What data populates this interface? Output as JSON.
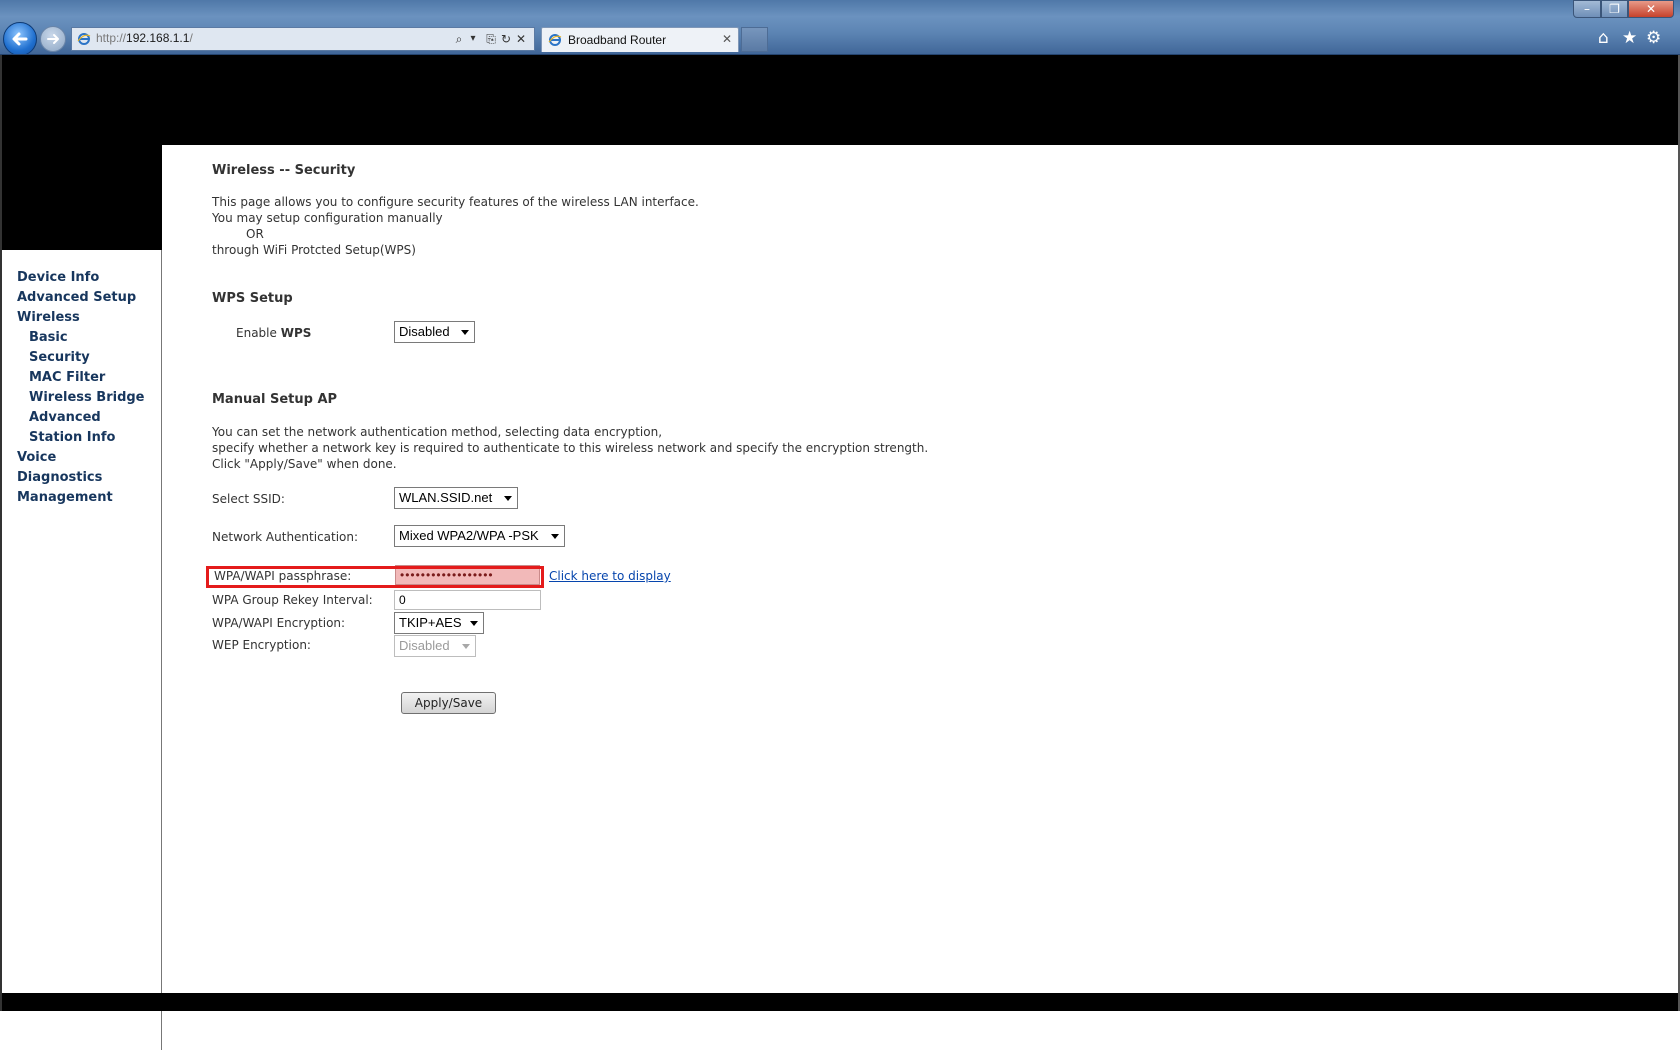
{
  "browser": {
    "address": {
      "protocol": "http://",
      "host": "192.168.1.1",
      "path": "/"
    },
    "tab_title": "Broadband Router",
    "tab_close": "✕",
    "window_controls": {
      "minimize": "–",
      "maximize": "❐",
      "close": "✕"
    },
    "toolbar_icons": {
      "home": "⌂",
      "favorites": "★",
      "tools": "⚙"
    },
    "address_icons": {
      "search": "⌕",
      "dropdown": "▾",
      "compat": "⎘",
      "refresh": "↻",
      "stop": "✕"
    }
  },
  "sidebar": {
    "items": [
      {
        "label": "Device Info",
        "level": 0
      },
      {
        "label": "Advanced Setup",
        "level": 0
      },
      {
        "label": "Wireless",
        "level": 0
      },
      {
        "label": "Basic",
        "level": 1
      },
      {
        "label": "Security",
        "level": 1
      },
      {
        "label": "MAC Filter",
        "level": 1
      },
      {
        "label": "Wireless Bridge",
        "level": 1
      },
      {
        "label": "Advanced",
        "level": 1
      },
      {
        "label": "Station Info",
        "level": 1
      },
      {
        "label": "Voice",
        "level": 0
      },
      {
        "label": "Diagnostics",
        "level": 0
      },
      {
        "label": "Management",
        "level": 0
      }
    ]
  },
  "page": {
    "title": "Wireless -- Security",
    "intro": [
      "This page allows you to configure security features of the wireless LAN interface.",
      "You may setup configuration manually",
      "OR",
      "through WiFi Protcted Setup(WPS)"
    ],
    "wps": {
      "heading": "WPS Setup",
      "enable_label_prefix": "Enable ",
      "enable_label_bold": "WPS",
      "enable_value": "Disabled"
    },
    "manual": {
      "heading": "Manual Setup AP",
      "description": [
        "You can set the network authentication method, selecting data encryption,",
        "specify whether a network key is required to authenticate to this wireless network and specify the encryption strength.",
        "Click \"Apply/Save\" when done."
      ],
      "ssid_label": "Select SSID:",
      "ssid_value": "WLAN.SSID.net",
      "auth_label": "Network Authentication:",
      "auth_value": "Mixed WPA2/WPA -PSK",
      "passphrase_label": "WPA/WAPI passphrase:",
      "passphrase_value": "••••••••••••••••••",
      "passphrase_link": "Click here to display",
      "rekey_label": "WPA Group Rekey Interval:",
      "rekey_value": "0",
      "encryption_label": "WPA/WAPI Encryption:",
      "encryption_value": "TKIP+AES",
      "wep_label": "WEP Encryption:",
      "wep_value": "Disabled"
    },
    "apply_button": "Apply/Save"
  },
  "colors": {
    "highlight": "#e41b1b",
    "menu_text": "#17365d",
    "link": "#0645ad"
  }
}
